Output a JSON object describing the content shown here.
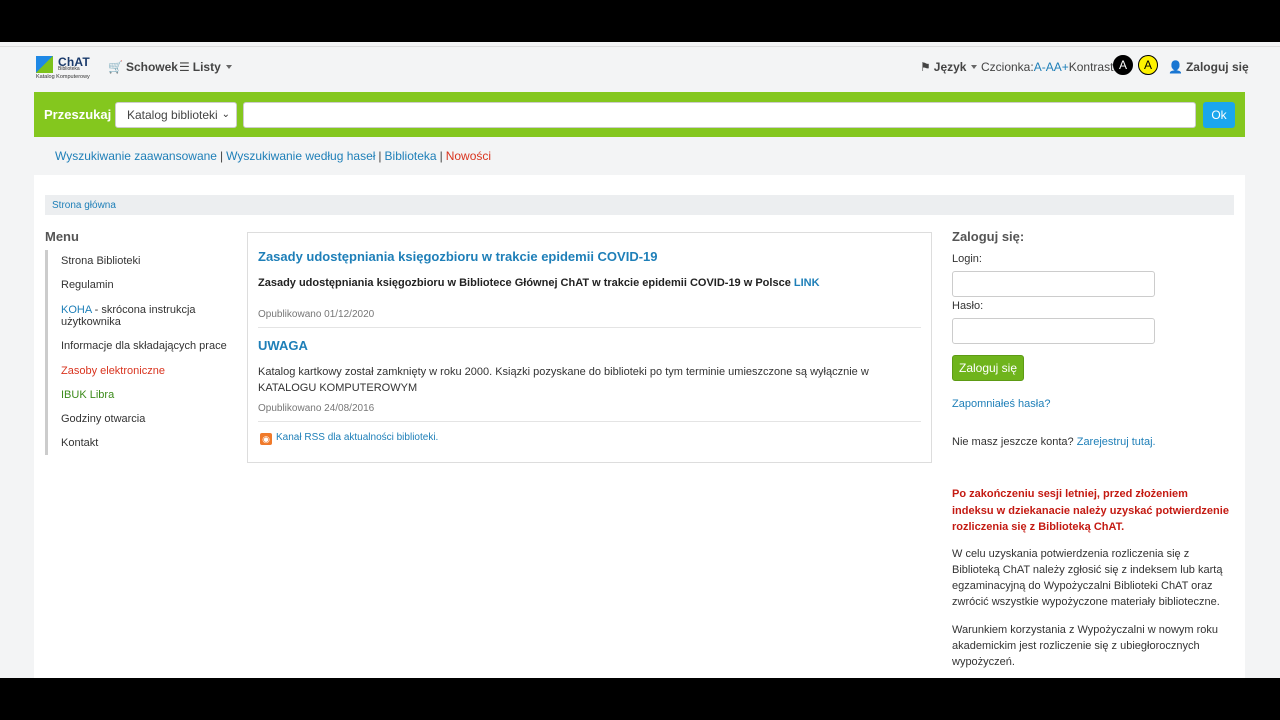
{
  "header": {
    "logo": {
      "title": "ChAT",
      "subtitle": "Biblioteka",
      "caption": "Katalog Komputerowy"
    },
    "cart_label": "Schowek",
    "lists_label": "Listy",
    "language_label": "Język",
    "font_label": "Czcionka:",
    "font_a": "A",
    "font_aa": "-AA+",
    "contrast_label": "Kontrast:",
    "contrast_a": "A",
    "contrast_dark": "A",
    "contrast_yellow": "A",
    "login_label": "Zaloguj się"
  },
  "search": {
    "label": "Przeszukaj",
    "index_selected": "Katalog biblioteki",
    "query": "",
    "submit_label": "Ok"
  },
  "links": {
    "advanced": "Wyszukiwanie zaawansowane",
    "authority": "Wyszukiwanie według haseł",
    "library": "Biblioteka",
    "news": "Nowości",
    "separator": "|"
  },
  "breadcrumb": "Strona główna",
  "menu": {
    "title": "Menu",
    "items": [
      {
        "label": "Strona Biblioteki"
      },
      {
        "label": "Regulamin"
      },
      {
        "label_link": "KOHA",
        "label_rest": " - skrócona instrukcja użytkownika"
      },
      {
        "label": "Informacje dla składających prace"
      },
      {
        "label": "Zasoby elektroniczne"
      },
      {
        "label": "IBUK Libra"
      },
      {
        "label": "Godziny otwarcia"
      },
      {
        "label": "Kontakt"
      }
    ]
  },
  "news": [
    {
      "title": "Zasady udostępniania księgozbioru w trakcie epidemii COVID-19",
      "body": "Zasady udostępniania księgozbioru w Bibliotece Głównej ChAT w trakcie epidemii COVID-19 w Polsce ",
      "body_link": "LINK",
      "date": "Opublikowano 01/12/2020"
    },
    {
      "title": "UWAGA",
      "body": "Katalog kartkowy został zamknięty w roku 2000. Ksiązki pozyskane do biblioteki po tym terminie umieszczone są wyłącznie w KATALOGU KOMPUTEROWYM",
      "date": "Opublikowano 24/08/2016"
    }
  ],
  "rss_label": "Kanał RSS dla aktualności biblioteki.",
  "login_box": {
    "title": "Zaloguj się:",
    "login_label": "Login:",
    "login_value": "",
    "password_label": "Hasło:",
    "password_value": "",
    "submit_label": "Zaloguj się",
    "forgot_label": "Zapomniałeś hasła?",
    "no_account": "Nie masz jeszcze konta? ",
    "register_label": "Zarejestruj tutaj."
  },
  "notice": {
    "warning": "Po zakończeniu sesji letniej, przed złożeniem indeksu w dziekanacie należy uzyskać potwierdzenie rozliczenia się z Biblioteką ChAT.",
    "para1": "W celu uzyskania potwierdzenia rozliczenia się z Biblioteką ChAT należy zgłosić się z indeksem lub kartą egzaminacyjną do Wypożyczalni Biblioteki ChAT oraz zwrócić wszystkie wypożyczone materiały biblioteczne.",
    "para2": "Warunkiem korzystania z Wypożyczalni w nowym roku akademickim jest rozliczenie się z ubiegłorocznych wypożyczeń."
  },
  "colors": {
    "accent_green": "#84c71e",
    "link_blue": "#1e7fb8",
    "button_blue": "#1aa6ed",
    "warning_red": "#c41a12"
  }
}
